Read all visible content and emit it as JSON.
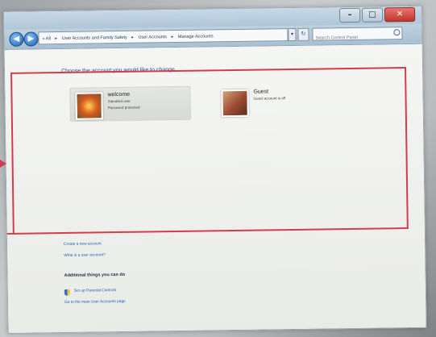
{
  "window": {
    "caption": {
      "minimize": "–",
      "maximize": "□",
      "close": "✕"
    }
  },
  "navbar": {
    "back_glyph": "◀",
    "forward_glyph": "▶",
    "breadcrumbs": [
      "« All",
      "User Accounts and Family Safety",
      "User Accounts",
      "Manage Accounts"
    ],
    "separator": "▸",
    "dropdown_glyph": "▾",
    "refresh_glyph": "↻",
    "search_placeholder": "Search Control Panel"
  },
  "content": {
    "heading": "Choose the account you would like to change",
    "accounts": [
      {
        "name": "welcome",
        "line1": "Standard user",
        "line2": "Password protected",
        "picture": "flower-picture"
      },
      {
        "name": "Guest",
        "line1": "Guest account is off",
        "line2": "",
        "picture": "guest-picture"
      }
    ],
    "links": {
      "create": "Create a new account",
      "what_is": "What is a user account?"
    },
    "additional": {
      "heading": "Additional things you can do",
      "parental": "Set up Parental Controls",
      "main_page": "Go to the main User Accounts page"
    }
  },
  "colors": {
    "link": "#2060b0",
    "heading": "#1f4e8c",
    "annotation_red": "#d23c4d"
  }
}
